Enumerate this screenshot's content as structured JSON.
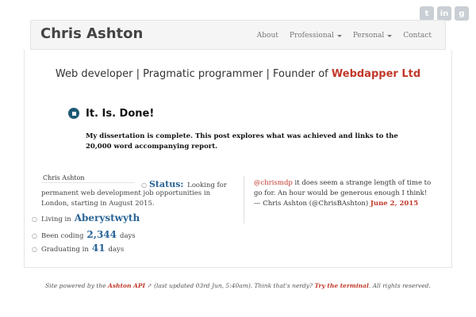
{
  "social": {
    "icons": [
      "twitter-icon",
      "linkedin-icon",
      "github-icon"
    ],
    "glyphs": [
      "t",
      "in",
      "g"
    ]
  },
  "navbar": {
    "brand": "Chris Ashton",
    "items": [
      {
        "label": "About",
        "dropdown": false
      },
      {
        "label": "Professional",
        "dropdown": true
      },
      {
        "label": "Personal",
        "dropdown": true
      },
      {
        "label": "Contact",
        "dropdown": false
      }
    ]
  },
  "tagline": {
    "text": "Web developer | Pragmatic programmer | Founder of ",
    "company": "Webdapper Ltd"
  },
  "post": {
    "title": "It. Is. Done!",
    "summary": "My dissertation is complete. This post explores what was achieved and links to the 20,000 word accompanying report."
  },
  "status": {
    "name": "Chris Ashton",
    "label": "Status:",
    "text_start": "Looking for",
    "text_rest": "permanent web development job opportunities in London, starting in August 2015."
  },
  "stats": [
    {
      "prefix": "Living in",
      "value": "Aberystwyth",
      "suffix": ""
    },
    {
      "prefix": "Been coding",
      "value": "2,344",
      "suffix": "days"
    },
    {
      "prefix": "Graduating in",
      "value": "41",
      "suffix": "days"
    }
  ],
  "tweet": {
    "mention": "@chrismdp",
    "text": " it does seem a strange length of time to go for. An hour would be generous enough I think!",
    "attribution": "— Chris Ashton (@ChrisBAshton) ",
    "date": "June 2, 2015"
  },
  "footer": {
    "prefix": "Site powered by the ",
    "api_link": "Ashton API",
    "api_icon": "↗",
    "middle": " (last updated 03rd Jun, 5:40am). Think that's nerdy? ",
    "terminal_link": "Try the terminal",
    "suffix": ". All rights reserved."
  },
  "colors": {
    "accent": "#c0392b",
    "stat_blue": "#2a6496",
    "icon_grey": "#c9cfd4",
    "post_icon": "#1c5a73"
  }
}
